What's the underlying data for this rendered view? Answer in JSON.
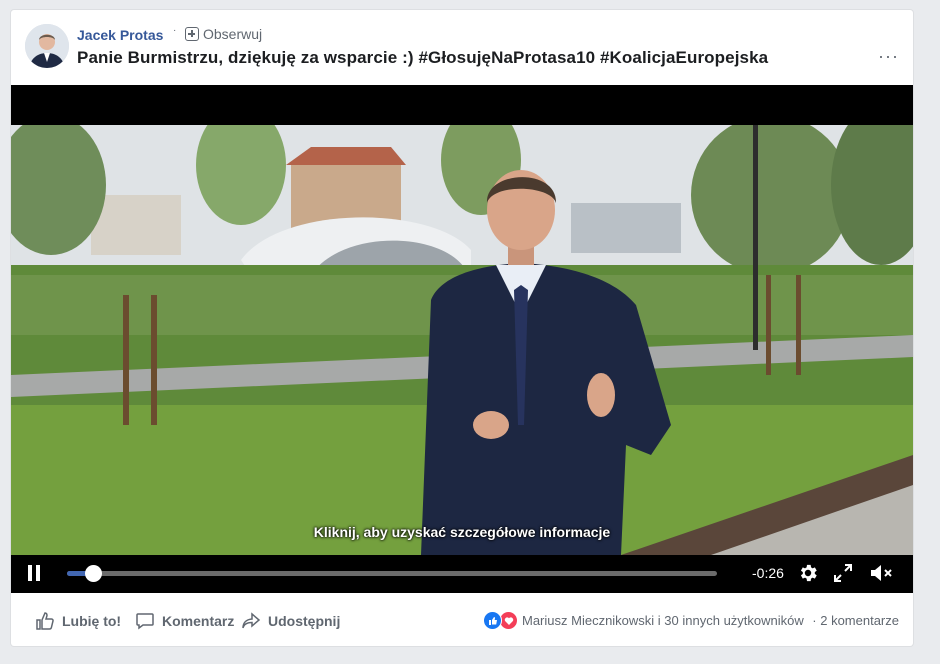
{
  "post": {
    "author": "Jacek Protas",
    "follow_label": "Obserwuj",
    "text": "Panie Burmistrzu, dziękuję za wsparcie :) #GłosujęNaProtasa10 #KoalicjaEuropejska",
    "more_menu": "···"
  },
  "video": {
    "caption": "Kliknij, aby uzyskać szczegółowe informacje",
    "time_remaining": "-0:26",
    "progress": 0.04
  },
  "actions": {
    "like_label": "Lubię to!",
    "comment_label": "Komentarz",
    "share_label": "Udostępnij"
  },
  "reactions": {
    "names": "Mariusz Miecznikowski i 30 innych użytkowników",
    "separator": "·",
    "comments": "2 komentarze"
  },
  "colors": {
    "author_link": "#365899",
    "progress": "#4267b2",
    "like_reaction": "#1877f2",
    "love_reaction": "#f33e58"
  }
}
